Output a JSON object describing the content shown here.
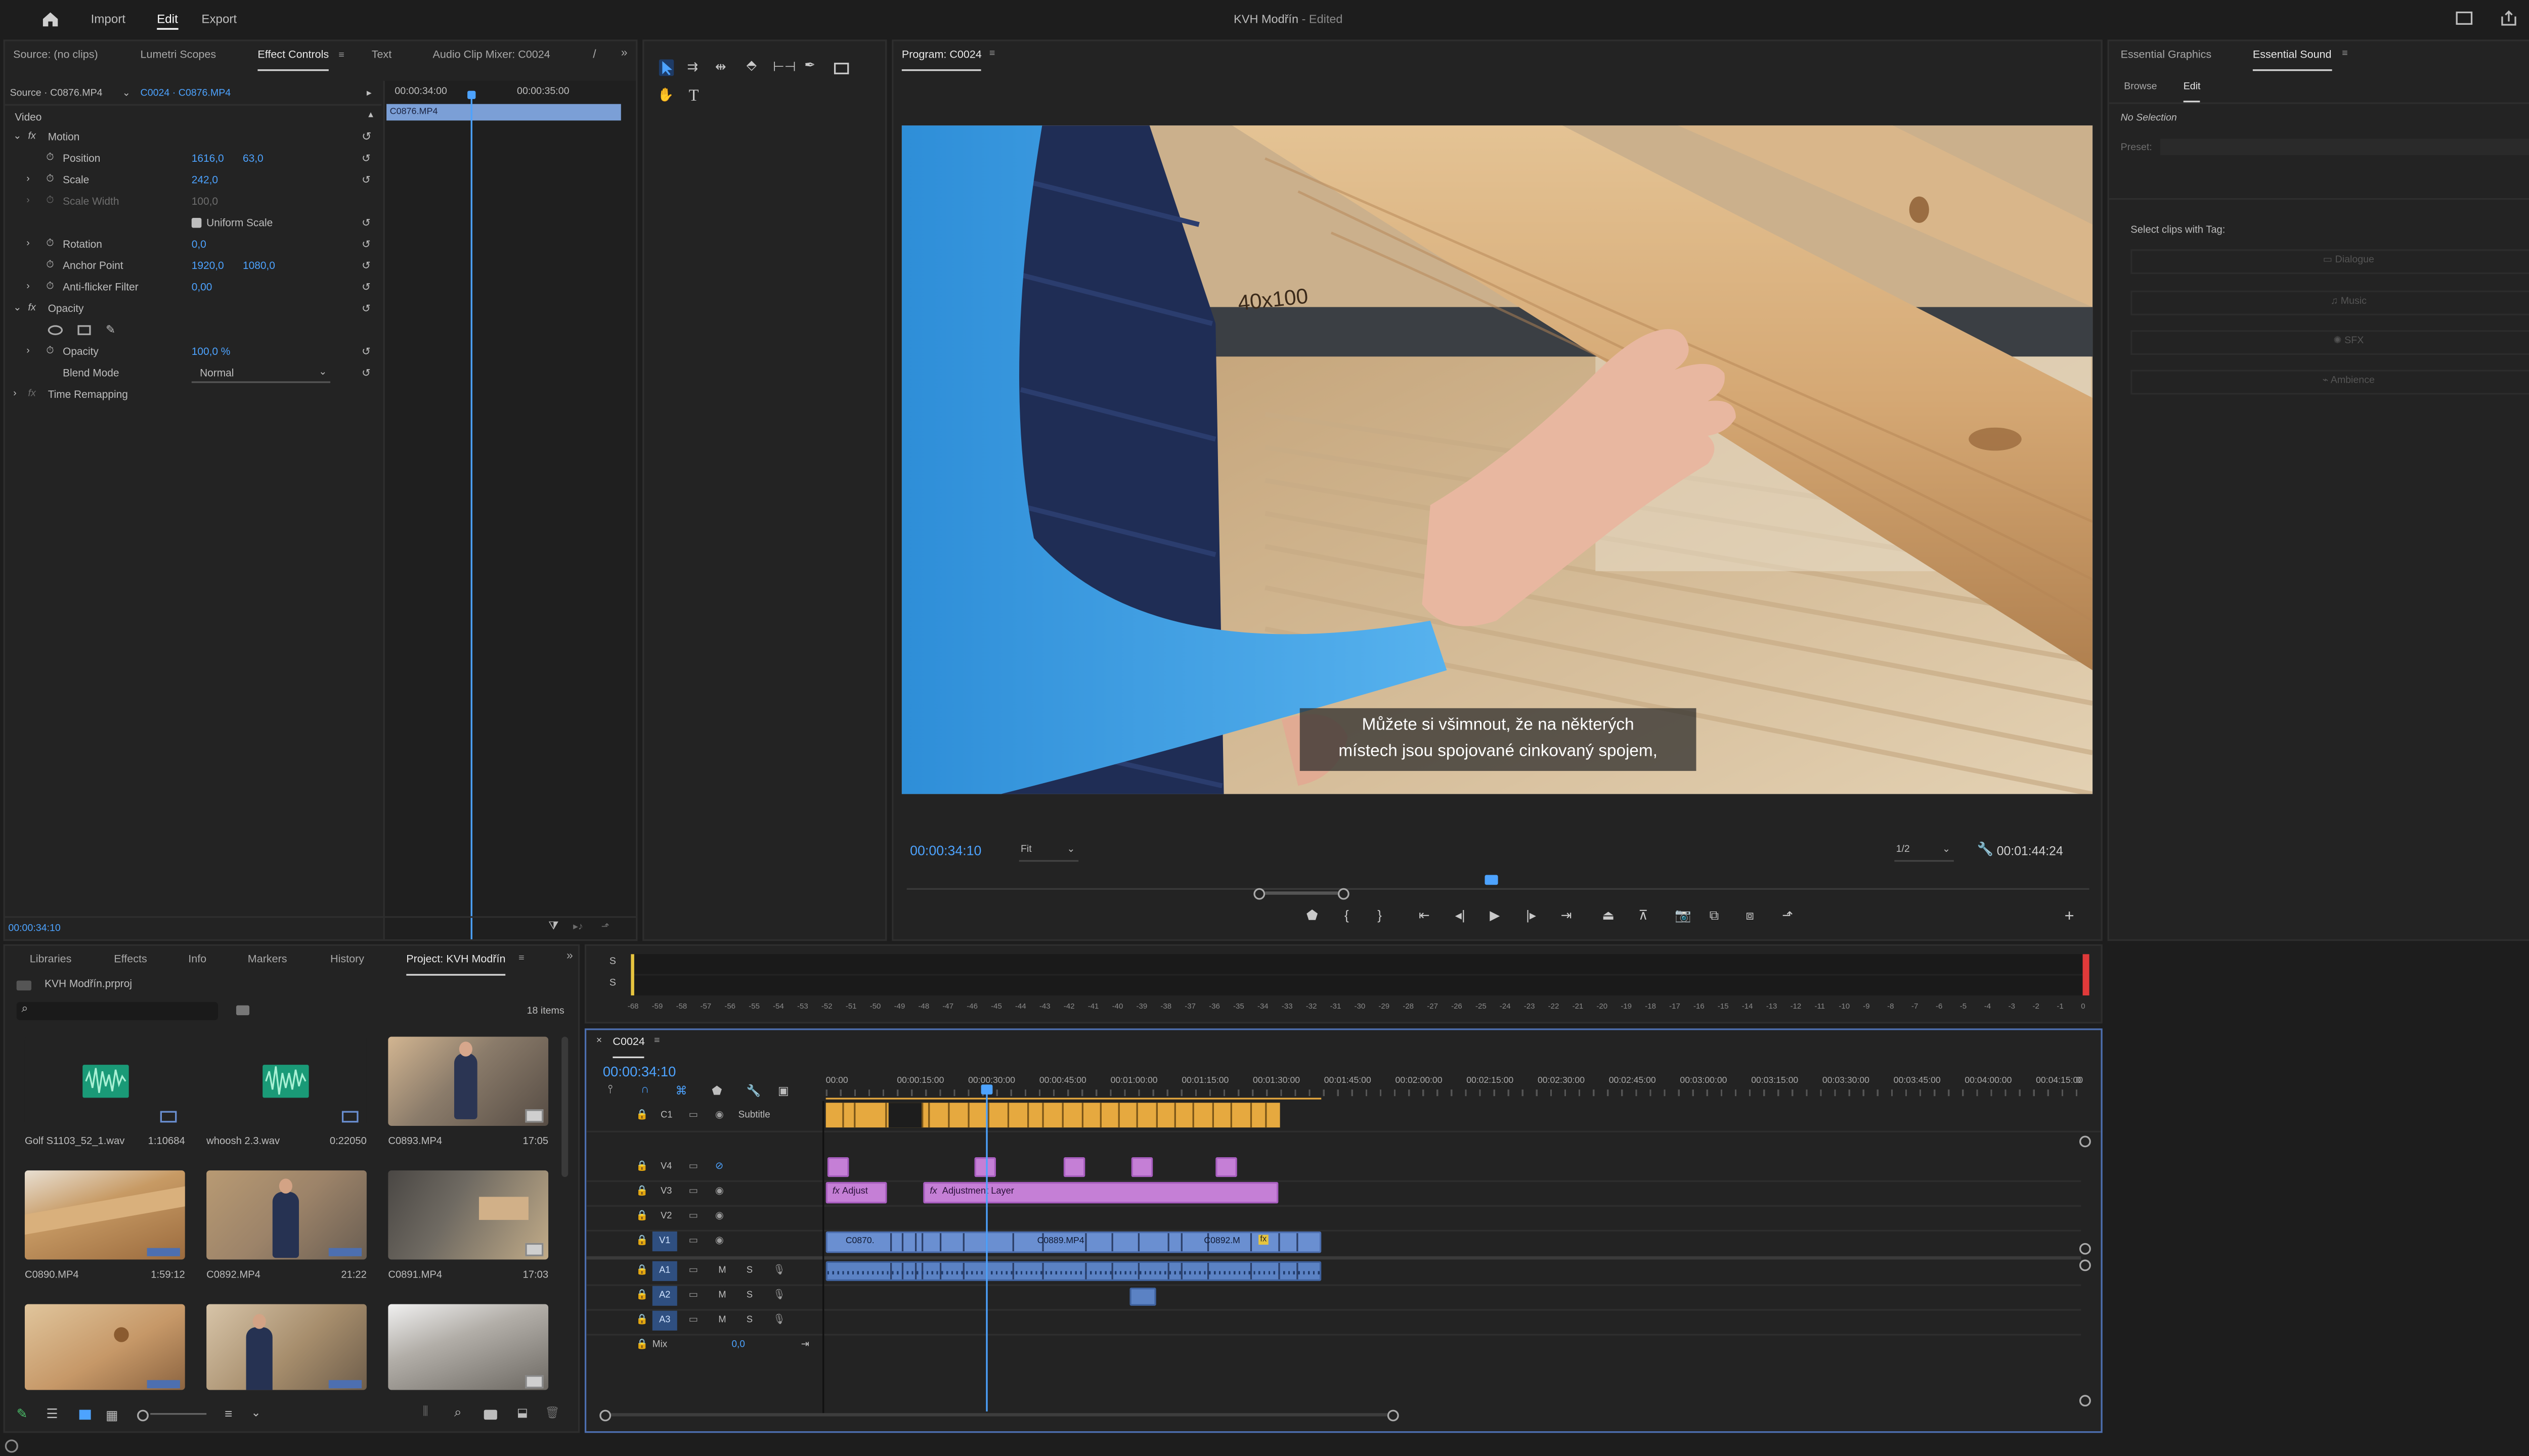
{
  "app": {
    "title": "KVH Modřín",
    "title_status": "- Edited",
    "menu": [
      "Import",
      "Edit",
      "Export"
    ],
    "active_menu": "Edit"
  },
  "source_panel": {
    "tabs": [
      "Source: (no clips)",
      "Lumetri Scopes",
      "Effect Controls",
      "Text",
      "Audio Clip Mixer: C0024"
    ],
    "active_tab": "Effect Controls",
    "source_label": "Source · C0876.MP4",
    "sequence_label": "C0024 · C0876.MP4",
    "timecode_left": "00:00:34:00",
    "timecode_right": "00:00:35:00",
    "clip_bar_label": "C0876.MP4",
    "section_video": "Video",
    "motion": "Motion",
    "position_label": "Position",
    "position_x": "1616,0",
    "position_y": "63,0",
    "scale_label": "Scale",
    "scale_value": "242,0",
    "scale_width_label": "Scale Width",
    "scale_width_value": "100,0",
    "uniform_scale": "Uniform Scale",
    "rotation_label": "Rotation",
    "rotation_value": "0,0",
    "anchor_label": "Anchor Point",
    "anchor_x": "1920,0",
    "anchor_y": "1080,0",
    "antiflicker_label": "Anti-flicker Filter",
    "antiflicker_value": "0,00",
    "opacity_section": "Opacity",
    "opacity_label": "Opacity",
    "opacity_value": "100,0 %",
    "blend_label": "Blend Mode",
    "blend_value": "Normal",
    "time_remap": "Time Remapping",
    "footer_timecode": "00:00:34:10"
  },
  "program_panel": {
    "title": "Program: C0024",
    "subtitle_line1": "Můžete si všimnout, že na některých",
    "subtitle_line2": "místech jsou spojované cinkovaný spojem,",
    "frame_text": "40x100",
    "timecode": "00:00:34:10",
    "fit_label": "Fit",
    "resolution_label": "1/2",
    "duration": "00:01:44:24"
  },
  "essential_panel": {
    "tabs": [
      "Essential Graphics",
      "Essential Sound"
    ],
    "active_tab": "Essential Sound",
    "subtabs": [
      "Browse",
      "Edit"
    ],
    "active_subtab": "Edit",
    "no_selection": "No Selection",
    "preset_label": "Preset:",
    "tag_label": "Select clips with Tag:",
    "tags": [
      "Dialogue",
      "Music",
      "SFX",
      "Ambience"
    ]
  },
  "project_panel": {
    "tabs": [
      "Libraries",
      "Effects",
      "Info",
      "Markers",
      "History",
      "Project: KVH Modřín"
    ],
    "active_tab": "Project: KVH Modřín",
    "file_name": "KVH Modřín.prproj",
    "items_count": "18 items",
    "items": [
      {
        "name": "Golf S1103_52_1.wav",
        "duration": "1:10684"
      },
      {
        "name": "whoosh 2.3.wav",
        "duration": "0:22050"
      },
      {
        "name": "C0893.MP4",
        "duration": "17:05"
      },
      {
        "name": "C0890.MP4",
        "duration": "1:59:12"
      },
      {
        "name": "C0892.MP4",
        "duration": "21:22"
      },
      {
        "name": "C0891.MP4",
        "duration": "17:03"
      },
      {
        "name": "",
        "duration": ""
      },
      {
        "name": "",
        "duration": ""
      },
      {
        "name": "",
        "duration": ""
      }
    ]
  },
  "meter": {
    "labels": [
      "-68",
      "-59",
      "-58",
      "-57",
      "-56",
      "-55",
      "-54",
      "-53",
      "-52",
      "-51",
      "-50",
      "-49",
      "-48",
      "-47",
      "-46",
      "-45",
      "-44",
      "-43",
      "-42",
      "-41",
      "-40",
      "-39",
      "-38",
      "-37",
      "-36",
      "-35",
      "-34",
      "-33",
      "-32",
      "-31",
      "-30",
      "-29",
      "-28",
      "-27",
      "-26",
      "-25",
      "-24",
      "-23",
      "-22",
      "-21",
      "-20",
      "-19",
      "-18",
      "-17",
      "-16",
      "-15",
      "-14",
      "-13",
      "-12",
      "-11",
      "-10",
      "-9",
      "-8",
      "-7",
      "-6",
      "-5",
      "-4",
      "-3",
      "-2",
      "-1",
      "0"
    ],
    "solo_1": "S",
    "solo_2": "S"
  },
  "timeline": {
    "sequence": "C0024",
    "timecode": "00:00:34:10",
    "ruler": [
      "00:00",
      "00:00:15:00",
      "00:00:30:00",
      "00:00:45:00",
      "00:01:00:00",
      "00:01:15:00",
      "00:01:30:00",
      "00:01:45:00",
      "00:02:00:00",
      "00:02:15:00",
      "00:02:30:00",
      "00:02:45:00",
      "00:03:00:00",
      "00:03:15:00",
      "00:03:30:00",
      "00:03:45:00",
      "00:04:00:00",
      "00:04:15:00",
      "0"
    ],
    "tracks": {
      "subtitle": {
        "id": "C1",
        "name": "Subtitle"
      },
      "v4": "V4",
      "v3": "V3",
      "v2": "V2",
      "v1": "V1",
      "a1": "A1",
      "a2": "A2",
      "a3": "A3",
      "mix": "Mix",
      "mix_value": "0,0",
      "mute": "M",
      "solo": "S"
    },
    "clips": {
      "adjust_short": "Adjust",
      "adjust_long": "Adjustment Layer",
      "v1_a": "C0870.",
      "v1_b": "C0889.MP4",
      "v1_c": "C0892.M",
      "v1_fx": "fx"
    }
  },
  "colors": {
    "accent_blue": "#4da3ff",
    "subtitle_clip": "#e6a93f",
    "adjustment_clip": "#c57fd6",
    "video_clip": "#6a8fd1",
    "audio_clip": "#5b82c4",
    "meter_peak": "#e03a3a"
  },
  "icons": [
    "home-icon",
    "panel-layout-icon",
    "share-icon",
    "fullscreen-icon",
    "selection-tool-icon",
    "track-select-icon",
    "ripple-edit-icon",
    "razor-icon",
    "slip-icon",
    "pen-icon",
    "rectangle-icon",
    "hand-icon",
    "type-icon",
    "marker-icon",
    "mark-in-icon",
    "mark-out-icon",
    "go-to-in-icon",
    "step-back-icon",
    "play-icon",
    "step-forward-icon",
    "go-to-out-icon",
    "lift-icon",
    "extract-icon",
    "export-frame-icon",
    "comparison-icon",
    "wrench-icon",
    "add-button-icon",
    "search-icon",
    "new-bin-icon",
    "magnet-icon",
    "link-icon",
    "lock-icon",
    "eye-icon",
    "microphone-icon",
    "audio-waveform-icon"
  ]
}
